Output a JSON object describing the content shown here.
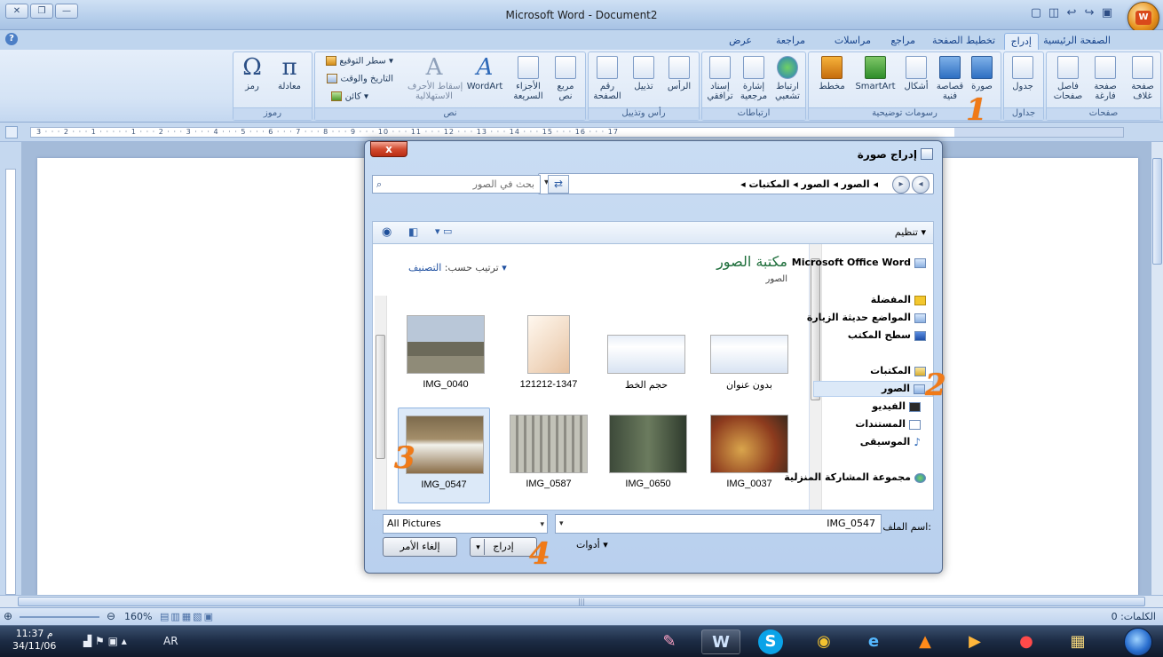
{
  "window": {
    "title": "Microsoft Word - Document2",
    "quick_access": [
      "save",
      "undo",
      "redo"
    ]
  },
  "tabs": [
    {
      "label": "الصفحة الرئيسية"
    },
    {
      "label": "إدراج"
    },
    {
      "label": "تخطيط الصفحة"
    },
    {
      "label": "مراجع"
    },
    {
      "label": "مراسلات"
    },
    {
      "label": "مراجعة"
    },
    {
      "label": "عرض"
    }
  ],
  "ribbon": {
    "pages": {
      "label": "صفحات",
      "cover": "صفحة\nغلاف",
      "blank": "صفحة\nفارغة",
      "break": "فاصل\nصفحات"
    },
    "tables": {
      "label": "جداول",
      "table": "جدول"
    },
    "illustrations": {
      "label": "رسومات توضيحية",
      "picture": "صورة",
      "clipart": "قصاصة\nفنية",
      "shapes": "أشكال",
      "smartart": "SmartArt",
      "chart": "مخطط"
    },
    "links": {
      "label": "ارتباطات",
      "hyperlink": "ارتباط\nتشعبي",
      "bookmark": "إشارة\nمرجعية",
      "crossref": "إسناد\nترافقي"
    },
    "headerfooter": {
      "label": "رأس وتذييل",
      "header": "الرأس",
      "footer": "تذييل",
      "pagenum": "رقم\nالصفحة"
    },
    "text": {
      "label": "نص",
      "textbox": "مربع\nنص",
      "quickparts": "الأجزاء\nالسريعة",
      "wordart": "WordArt",
      "dropcap": "إسقاط الأحرف\nالاستهلالية",
      "signature": "سطر التوقيع",
      "datetime": "التاريخ والوقت",
      "object": "كائن"
    },
    "symbols": {
      "label": "رموز",
      "equation": "معادلة",
      "symbol": "رمز",
      "pi": "π",
      "omega": "Ω"
    }
  },
  "ruler": {
    "text": "3 · · · 2 · · · 1 · · · · · 1 · · · 2 · · · 3 · · · 4 · · · 5 · · · 6 · · · 7 · · · 8 · · · 9 · · · 10 · · · 11 · · · 12 · · · 13 · · · 14 · · · 15 · · · 16 · · · 17"
  },
  "dialog": {
    "title": "إدراج صورة",
    "close": "x",
    "breadcrumb": "◂ الصور ◂ الصور ◂ المكتبات ◂",
    "search_placeholder": "بحث في الصور",
    "organize": "تنظيم ▾",
    "library_title": "مكتبة الصور",
    "library_sub": "الصور",
    "arrange_by": "ترتيب حسب:",
    "arrange_value": "التصنيف ▾",
    "nav": [
      {
        "label": "Microsoft Office Word"
      },
      {
        "label": "المفضلة"
      },
      {
        "label": "المواضع حديثة الزيارة"
      },
      {
        "label": "سطح المكتب"
      },
      {
        "label": "المكتبات"
      },
      {
        "label": "الصور"
      },
      {
        "label": "الفيديو"
      },
      {
        "label": "المستندات"
      },
      {
        "label": "الموسيقى"
      },
      {
        "label": "مجموعة المشاركة المنزلية"
      }
    ],
    "thumbs": [
      {
        "label": "IMG_0040"
      },
      {
        "label": "121212-1347"
      },
      {
        "label": "حجم الخط"
      },
      {
        "label": "بدون عنوان"
      },
      {
        "label": "IMG_0547"
      },
      {
        "label": "IMG_0587"
      },
      {
        "label": "IMG_0650"
      },
      {
        "label": "IMG_0037"
      }
    ],
    "filename_label": "اسم الملف:",
    "filename_value": "IMG_0547",
    "filter": "All Pictures",
    "tools": "أدوات",
    "insert": "إدراج",
    "cancel": "إلغاء الأمر"
  },
  "status": {
    "words": "الكلمات: 0",
    "zoom": "160%"
  },
  "taskbar": {
    "time": "11:37 م",
    "date": "34/11/06",
    "lang": "AR"
  },
  "annotations": [
    "1",
    "2",
    "3",
    "4"
  ],
  "colors": {
    "accent": "#15428b",
    "annotation": "#f07a18",
    "ribbon": "#dbe7f6"
  }
}
